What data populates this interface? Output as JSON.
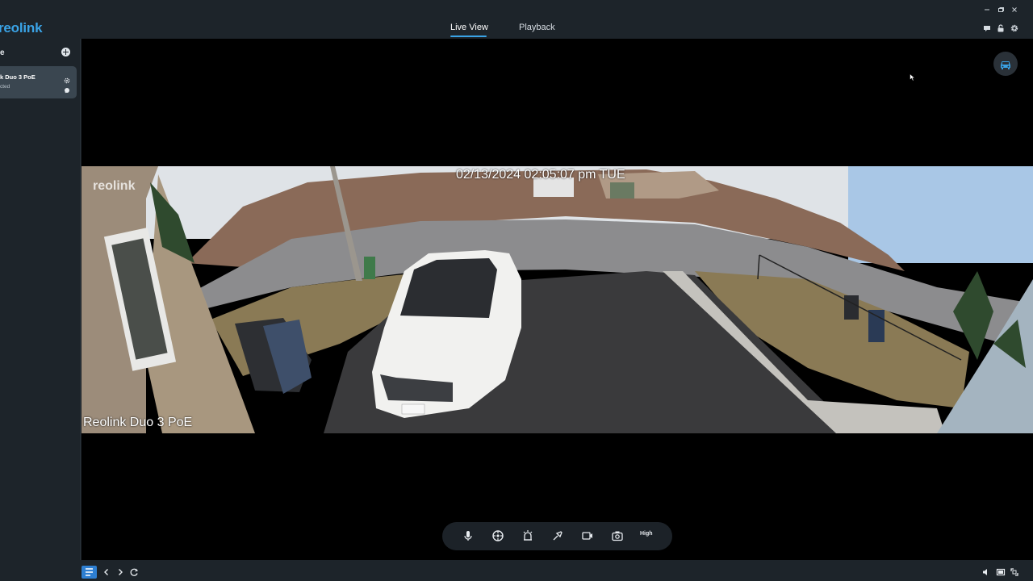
{
  "app": {
    "logo_text": "reolink"
  },
  "header": {
    "tabs": [
      {
        "label": "Live View",
        "active": true
      },
      {
        "label": "Playback",
        "active": false
      }
    ],
    "window_controls": [
      "minimize-icon",
      "restore-icon",
      "close-icon"
    ],
    "icons": [
      "message-icon",
      "lock-icon",
      "gear-icon"
    ]
  },
  "sidebar": {
    "heading": "e",
    "devices": [
      {
        "name": "k Duo 3 PoE",
        "status": "cted"
      }
    ]
  },
  "viewer": {
    "osd_timestamp": "02/13/2024 02:05:07 pm TUE",
    "osd_watermark": "reolink",
    "osd_camera_name": "Reolink Duo 3 PoE",
    "top_right_icon": "vehicle-icon"
  },
  "controls": {
    "icons": [
      "microphone-icon",
      "ptz-icon",
      "siren-icon",
      "spotlight-icon",
      "record-icon",
      "snapshot-icon"
    ],
    "quality_label": "High"
  },
  "bottombar": {
    "icons": [
      "layout-icon",
      "prev-icon",
      "next-icon",
      "refresh-icon",
      "volume-icon",
      "screen-icon",
      "fullscreen-icon"
    ]
  },
  "colors": {
    "accent": "#3aa3e6",
    "background": "#1d242a",
    "card": "#3a4650"
  }
}
